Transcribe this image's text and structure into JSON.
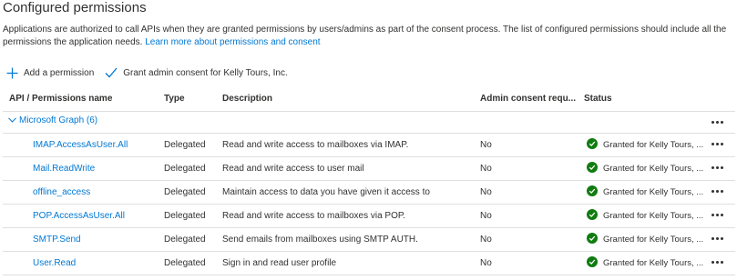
{
  "header": {
    "title": "Configured permissions",
    "description": "Applications are authorized to call APIs when they are granted permissions by users/admins as part of the consent process. The list of configured permissions should include all the permissions the application needs.",
    "learn_more": "Learn more about permissions and consent"
  },
  "toolbar": {
    "add_label": "Add a permission",
    "grant_label": "Grant admin consent for Kelly Tours, Inc."
  },
  "table": {
    "columns": {
      "name": "API / Permissions name",
      "type": "Type",
      "description": "Description",
      "admin": "Admin consent requ...",
      "status": "Status"
    },
    "group": {
      "label": "Microsoft Graph (6)"
    },
    "rows": [
      {
        "name": "IMAP.AccessAsUser.All",
        "type": "Delegated",
        "description": "Read and write access to mailboxes via IMAP.",
        "admin": "No",
        "status": "Granted for Kelly Tours, ..."
      },
      {
        "name": "Mail.ReadWrite",
        "type": "Delegated",
        "description": "Read and write access to user mail",
        "admin": "No",
        "status": "Granted for Kelly Tours, ..."
      },
      {
        "name": "offline_access",
        "type": "Delegated",
        "description": "Maintain access to data you have given it access to",
        "admin": "No",
        "status": "Granted for Kelly Tours, ..."
      },
      {
        "name": "POP.AccessAsUser.All",
        "type": "Delegated",
        "description": "Read and write access to mailboxes via POP.",
        "admin": "No",
        "status": "Granted for Kelly Tours, ..."
      },
      {
        "name": "SMTP.Send",
        "type": "Delegated",
        "description": "Send emails from mailboxes using SMTP AUTH.",
        "admin": "No",
        "status": "Granted for Kelly Tours, ..."
      },
      {
        "name": "User.Read",
        "type": "Delegated",
        "description": "Sign in and read user profile",
        "admin": "No",
        "status": "Granted for Kelly Tours, ..."
      }
    ]
  },
  "colors": {
    "link": "#0078d4",
    "success": "#107c10",
    "text": "#323130",
    "divider": "#e1dfdd"
  },
  "icons": {
    "add": "plus-icon",
    "grant": "checkmark-icon",
    "group_toggle": "chevron-down-icon",
    "status": "check-circle-icon",
    "more": "more-icon"
  }
}
